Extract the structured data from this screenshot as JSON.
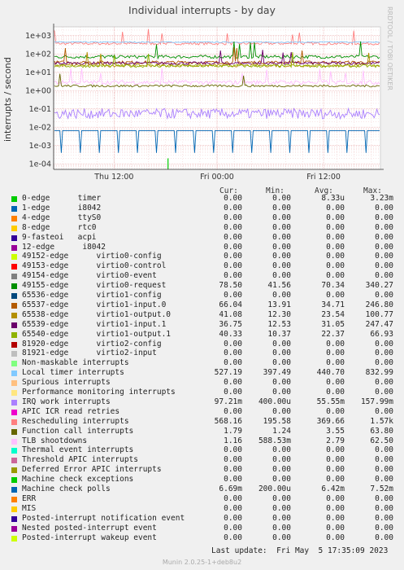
{
  "title": "Individual interrupts - by day",
  "ylabel": "interrupts / second",
  "right_text": "RRDTOOL / TOBI OETIKER",
  "legend_headers": [
    "Cur:",
    "Min:",
    "Avg:",
    "Max:"
  ],
  "rows": [
    {
      "label": "0-edge      timer",
      "color": "#00cc00",
      "cur": "0.00",
      "min": "0.00",
      "avg": "8.33u",
      "max": "3.23m"
    },
    {
      "label": "1-edge      i8042",
      "color": "#0066b3",
      "cur": "0.00",
      "min": "0.00",
      "avg": "0.00",
      "max": "0.00"
    },
    {
      "label": "4-edge      ttyS0",
      "color": "#ff8000",
      "cur": "0.00",
      "min": "0.00",
      "avg": "0.00",
      "max": "0.00"
    },
    {
      "label": "8-edge      rtc0",
      "color": "#ffcc00",
      "cur": "0.00",
      "min": "0.00",
      "avg": "0.00",
      "max": "0.00"
    },
    {
      "label": "9-fasteoi   acpi",
      "color": "#330099",
      "cur": "0.00",
      "min": "0.00",
      "avg": "0.00",
      "max": "0.00"
    },
    {
      "label": "12-edge      i8042",
      "color": "#990099",
      "cur": "0.00",
      "min": "0.00",
      "avg": "0.00",
      "max": "0.00"
    },
    {
      "label": "49152-edge      virtio0-config",
      "color": "#ccff00",
      "cur": "0.00",
      "min": "0.00",
      "avg": "0.00",
      "max": "0.00"
    },
    {
      "label": "49153-edge      virtio0-control",
      "color": "#ff0000",
      "cur": "0.00",
      "min": "0.00",
      "avg": "0.00",
      "max": "0.00"
    },
    {
      "label": "49154-edge      virtio0-event",
      "color": "#808080",
      "cur": "0.00",
      "min": "0.00",
      "avg": "0.00",
      "max": "0.00"
    },
    {
      "label": "49155-edge      virtio0-request",
      "color": "#008f00",
      "cur": "78.50",
      "min": "41.56",
      "avg": "70.34",
      "max": "340.27"
    },
    {
      "label": "65536-edge      virtio1-config",
      "color": "#00487d",
      "cur": "0.00",
      "min": "0.00",
      "avg": "0.00",
      "max": "0.00"
    },
    {
      "label": "65537-edge      virtio1-input.0",
      "color": "#b35a00",
      "cur": "66.04",
      "min": "13.91",
      "avg": "34.71",
      "max": "246.80"
    },
    {
      "label": "65538-edge      virtio1-output.0",
      "color": "#b38f00",
      "cur": "41.08",
      "min": "12.30",
      "avg": "23.54",
      "max": "100.77"
    },
    {
      "label": "65539-edge      virtio1-input.1",
      "color": "#6b006b",
      "cur": "36.75",
      "min": "12.53",
      "avg": "31.05",
      "max": "247.47"
    },
    {
      "label": "65540-edge      virtio1-output.1",
      "color": "#8fb300",
      "cur": "40.33",
      "min": "10.37",
      "avg": "22.37",
      "max": "66.93"
    },
    {
      "label": "81920-edge      virtio2-config",
      "color": "#b30000",
      "cur": "0.00",
      "min": "0.00",
      "avg": "0.00",
      "max": "0.00"
    },
    {
      "label": "81921-edge      virtio2-input",
      "color": "#bebebe",
      "cur": "0.00",
      "min": "0.00",
      "avg": "0.00",
      "max": "0.00"
    },
    {
      "label": "Non-maskable interrupts",
      "color": "#80ff80",
      "cur": "0.00",
      "min": "0.00",
      "avg": "0.00",
      "max": "0.00"
    },
    {
      "label": "Local timer interrupts",
      "color": "#80c9ff",
      "cur": "527.19",
      "min": "397.49",
      "avg": "440.70",
      "max": "832.99"
    },
    {
      "label": "Spurious interrupts",
      "color": "#ffc080",
      "cur": "0.00",
      "min": "0.00",
      "avg": "0.00",
      "max": "0.00"
    },
    {
      "label": "Performance monitoring interrupts",
      "color": "#ffe680",
      "cur": "0.00",
      "min": "0.00",
      "avg": "0.00",
      "max": "0.00"
    },
    {
      "label": "IRQ work interrupts",
      "color": "#aa80ff",
      "cur": "97.21m",
      "min": "400.00u",
      "avg": "55.55m",
      "max": "157.99m"
    },
    {
      "label": "APIC ICR read retries",
      "color": "#ee00cc",
      "cur": "0.00",
      "min": "0.00",
      "avg": "0.00",
      "max": "0.00"
    },
    {
      "label": "Rescheduling interrupts",
      "color": "#ff8080",
      "cur": "568.16",
      "min": "195.58",
      "avg": "369.66",
      "max": "1.57k"
    },
    {
      "label": "Function call interrupts",
      "color": "#666600",
      "cur": "1.79",
      "min": "1.24",
      "avg": "3.55",
      "max": "63.80"
    },
    {
      "label": "TLB shootdowns",
      "color": "#ffbfff",
      "cur": "1.16",
      "min": "588.53m",
      "avg": "2.79",
      "max": "62.50"
    },
    {
      "label": "Thermal event interrupts",
      "color": "#00ffcc",
      "cur": "0.00",
      "min": "0.00",
      "avg": "0.00",
      "max": "0.00"
    },
    {
      "label": "Threshold APIC interrupts",
      "color": "#cc6699",
      "cur": "0.00",
      "min": "0.00",
      "avg": "0.00",
      "max": "0.00"
    },
    {
      "label": "Deferred Error APIC interrupts",
      "color": "#999900",
      "cur": "0.00",
      "min": "0.00",
      "avg": "0.00",
      "max": "0.00"
    },
    {
      "label": "Machine check exceptions",
      "color": "#00cc00",
      "cur": "0.00",
      "min": "0.00",
      "avg": "0.00",
      "max": "0.00"
    },
    {
      "label": "Machine check polls",
      "color": "#0066b3",
      "cur": "6.69m",
      "min": "200.00u",
      "avg": "6.42m",
      "max": "7.52m"
    },
    {
      "label": "ERR",
      "color": "#ff8000",
      "cur": "0.00",
      "min": "0.00",
      "avg": "0.00",
      "max": "0.00"
    },
    {
      "label": "MIS",
      "color": "#ffcc00",
      "cur": "0.00",
      "min": "0.00",
      "avg": "0.00",
      "max": "0.00"
    },
    {
      "label": "Posted-interrupt notification event",
      "color": "#330099",
      "cur": "0.00",
      "min": "0.00",
      "avg": "0.00",
      "max": "0.00"
    },
    {
      "label": "Nested posted-interrupt event",
      "color": "#990099",
      "cur": "0.00",
      "min": "0.00",
      "avg": "0.00",
      "max": "0.00"
    },
    {
      "label": "Posted-interrupt wakeup event",
      "color": "#ccff00",
      "cur": "0.00",
      "min": "0.00",
      "avg": "0.00",
      "max": "0.00"
    }
  ],
  "last_update": "Last update:  Fri May  5 17:35:09 2023",
  "munin_version": "Munin 2.0.25-1+deb8u2",
  "chart_data": {
    "type": "line",
    "yscale": "log",
    "ylim": [
      5e-05,
      3000
    ],
    "yticks": [
      "1e+03",
      "1e+02",
      "1e+01",
      "1e+00",
      "1e-01",
      "1e-02",
      "1e-03",
      "1e-04"
    ],
    "xticks": [
      "Thu 12:00",
      "Fri 00:00",
      "Fri 12:00"
    ],
    "grid": true,
    "series": [
      {
        "name": "Rescheduling interrupts",
        "color": "#ff8080",
        "base": 370,
        "spread": 0.07,
        "spikes": 8
      },
      {
        "name": "Local timer interrupts",
        "color": "#80c9ff",
        "base": 440,
        "spread": 0.03,
        "spikes": 0
      },
      {
        "name": "49155-edge      virtio0-request",
        "color": "#008f00",
        "base": 70,
        "spread": 0.09,
        "spikes": 6
      },
      {
        "name": "65537-edge      virtio1-input.0",
        "color": "#b35a00",
        "base": 35,
        "spread": 0.08,
        "spikes": 4
      },
      {
        "name": "65539-edge      virtio1-input.1",
        "color": "#6b006b",
        "base": 31,
        "spread": 0.08,
        "spikes": 4
      },
      {
        "name": "65538-edge      virtio1-output.0",
        "color": "#b38f00",
        "base": 23.5,
        "spread": 0.08,
        "spikes": 3
      },
      {
        "name": "65540-edge      virtio1-output.1",
        "color": "#8fb300",
        "base": 22,
        "spread": 0.08,
        "spikes": 3
      },
      {
        "name": "TLB shootdowns",
        "color": "#ffbfff",
        "base": 2.8,
        "spread": 0.12,
        "spikes": 10
      },
      {
        "name": "Function call interrupts",
        "color": "#666600",
        "base": 1.8,
        "spread": 0.06,
        "spikes": 2
      },
      {
        "name": "IRQ work interrupts",
        "color": "#aa80ff",
        "base": 0.055,
        "spread": 0.28,
        "spikes": 0
      },
      {
        "name": "Machine check polls",
        "color": "#0066b3",
        "base": 0.0065,
        "spread": 0.0,
        "spikes": 0
      },
      {
        "name": "0-edge      timer",
        "color": "#00cc00",
        "base": 8.3e-06,
        "spread": 0.0,
        "spikes": 0
      }
    ]
  }
}
